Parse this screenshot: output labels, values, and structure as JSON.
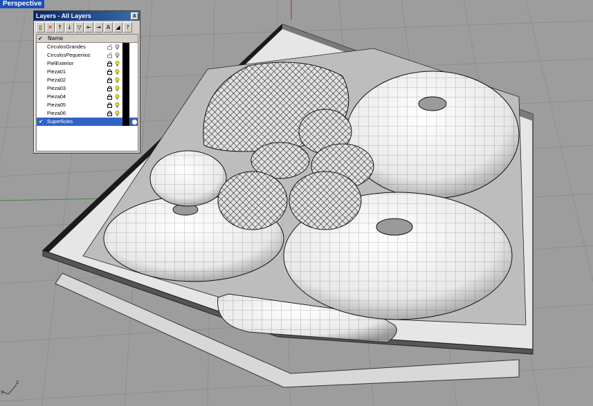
{
  "viewport": {
    "title": "Perspective",
    "axis_y": "y",
    "axis_z": "z"
  },
  "layers_panel": {
    "title": "Layers - All Layers",
    "close_glyph": "x",
    "header": {
      "check": "✔",
      "name": "Name"
    },
    "toolbar": [
      {
        "name": "new-layer-icon",
        "glyph": "▯"
      },
      {
        "name": "delete-layer-icon",
        "glyph": "✕",
        "red": true
      },
      {
        "name": "move-up-icon",
        "glyph": "↑"
      },
      {
        "name": "move-down-icon",
        "glyph": "↓"
      },
      {
        "name": "filter-icon",
        "glyph": "▽"
      },
      {
        "name": "select-objects-icon",
        "glyph": "⇤"
      },
      {
        "name": "change-layer-icon",
        "glyph": "⇥"
      },
      {
        "name": "font-icon",
        "glyph": "A"
      },
      {
        "name": "tools-icon",
        "glyph": "◢"
      },
      {
        "name": "help-icon",
        "glyph": "?"
      }
    ],
    "layers": [
      {
        "name": "CirculosGrandes",
        "locked": false,
        "visible": false,
        "current": false
      },
      {
        "name": "CirculosPequenios",
        "locked": false,
        "visible": false,
        "current": false
      },
      {
        "name": "PielExterior",
        "locked": true,
        "visible": true,
        "current": false
      },
      {
        "name": "Pieza01",
        "locked": true,
        "visible": true,
        "current": false
      },
      {
        "name": "Pieza02",
        "locked": true,
        "visible": true,
        "current": false
      },
      {
        "name": "Pieza03",
        "locked": true,
        "visible": true,
        "current": false
      },
      {
        "name": "Pieza04",
        "locked": true,
        "visible": true,
        "current": false
      },
      {
        "name": "Pieza05",
        "locked": true,
        "visible": true,
        "current": false
      },
      {
        "name": "Pieza06",
        "locked": true,
        "visible": true,
        "current": false
      },
      {
        "name": "Superficies",
        "locked": false,
        "visible": false,
        "current": true
      }
    ],
    "colors": {
      "selection": "#3162c5",
      "bulb_on": "#f4e200",
      "swatch": "#000000"
    }
  }
}
